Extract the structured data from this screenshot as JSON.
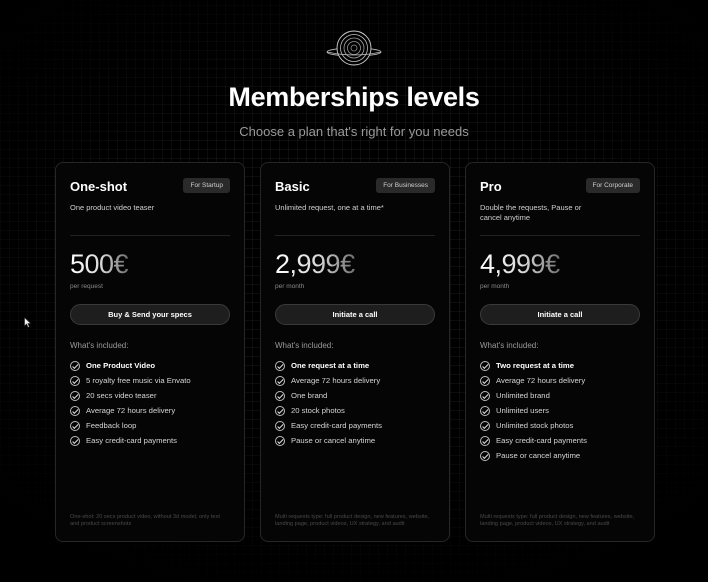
{
  "header": {
    "title": "Memberships levels",
    "subtitle": "Choose a plan that's right for you needs",
    "logo_icon": "concentric-circles-logo-icon"
  },
  "plans": [
    {
      "name": "One-shot",
      "badge": "For Startup",
      "description": "One product video teaser",
      "price": "500€",
      "period": "per request",
      "cta": "Buy & Send your specs",
      "included_label": "What's included:",
      "features": [
        "One Product Video",
        "5 royalty free music via Envato",
        "20 secs video teaser",
        "Average 72 hours delivery",
        "Feedback loop",
        "Easy credit-card payments"
      ],
      "footnote": "One-shot: 20 secs product video, without 3d model, only text and product screenshots"
    },
    {
      "name": "Basic",
      "badge": "For Businesses",
      "description": "Unlimited request, one at a time*",
      "price": "2,999€",
      "period": "per month",
      "cta": "Initiate a call",
      "included_label": "What's included:",
      "features": [
        "One request at a time",
        "Average 72 hours delivery",
        "One brand",
        "20 stock photos",
        "Easy credit-card payments",
        "Pause or cancel anytime"
      ],
      "footnote": "Multi requests type: full product design, new features, website, landing page, product videos, UX strategy, and audit"
    },
    {
      "name": "Pro",
      "badge": "For Corporate",
      "description": "Double the requests, Pause or cancel anytime",
      "price": "4,999€",
      "period": "per month",
      "cta": "Initiate a call",
      "included_label": "What's included:",
      "features": [
        "Two request at a time",
        "Average 72 hours delivery",
        "Unlimited brand",
        "Unlimited users",
        "Unlimited stock photos",
        "Easy credit-card payments",
        "Pause or cancel anytime"
      ],
      "footnote": "Multi requests type: full product design, new features, website, landing page, product videos, UX strategy, and audit"
    }
  ],
  "colors": {
    "background": "#000000",
    "card_border": "#262626",
    "badge_bg": "#2a2a2a",
    "button_bg": "#1e1e1e",
    "muted_text": "#9a9a9a"
  },
  "icons": {
    "feature_check": "check-circle-icon",
    "cursor": "mouse-pointer-icon"
  }
}
